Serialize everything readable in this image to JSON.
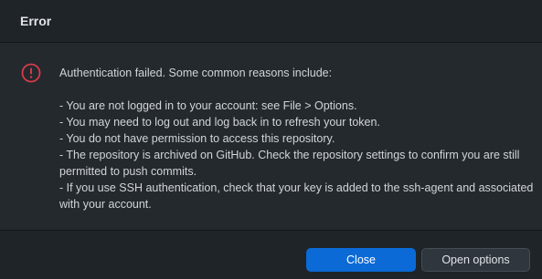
{
  "dialog": {
    "title": "Error",
    "icon": "alert-circle-icon",
    "icon_color": "#d73a49",
    "message": {
      "intro": "Authentication failed. Some common reasons include:",
      "reasons": [
        "- You are not logged in to your account: see File > Options.",
        "- You may need to log out and log back in to refresh your token.",
        "- You do not have permission to access this repository.",
        "- The repository is archived on GitHub. Check the repository settings to confirm you are still",
        "permitted to push commits.",
        "- If you use SSH authentication, check that your key is added to the ssh-agent and associated",
        "with your account."
      ]
    },
    "buttons": {
      "close_label": "Close",
      "open_options_label": "Open options"
    },
    "colors": {
      "primary_button": "#0b6ad6",
      "background": "#24292e",
      "titlebar": "#1f2428"
    }
  }
}
